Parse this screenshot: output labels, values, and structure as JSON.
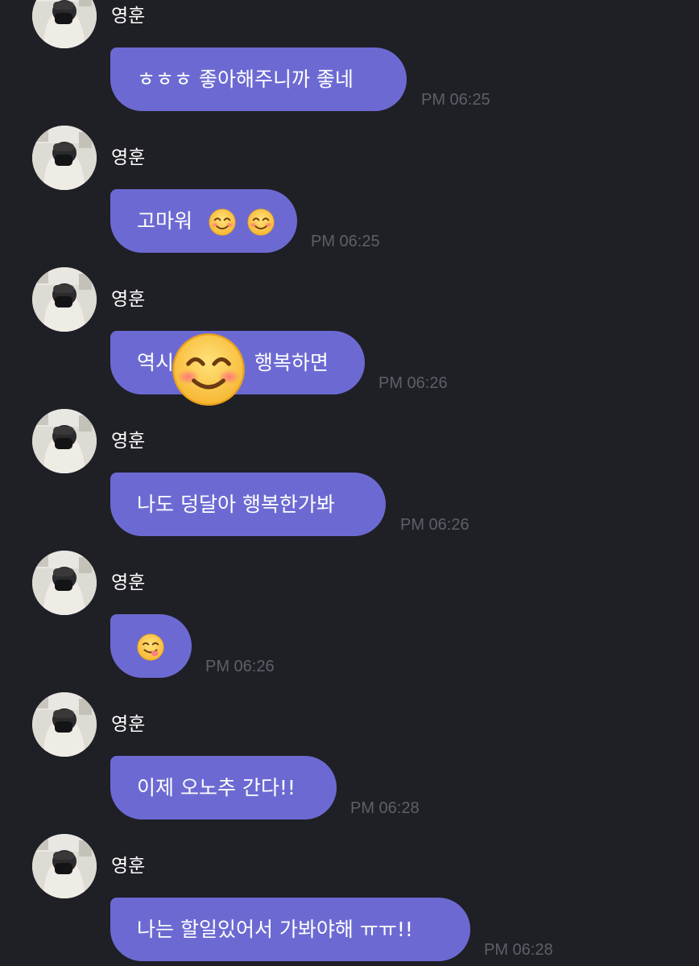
{
  "contact_name": "영훈",
  "colors": {
    "background": "#1f1f26",
    "bubble": "#6c6ad2",
    "timestamp": "#5f5f68"
  },
  "messages": [
    {
      "sender": "영훈",
      "text": "ㅎㅎㅎ 좋아해주니까 좋네",
      "time": "PM 06:25"
    },
    {
      "sender": "영훈",
      "text": "고마워",
      "emojis": [
        "smiling-blush-emoji",
        "smiling-blush-emoji"
      ],
      "time": "PM 06:25"
    },
    {
      "sender": "영훈",
      "text_before": "역시",
      "text_after": "행복하면",
      "overlay": "smiling-blush-emoji-sticker",
      "time": "PM 06:26"
    },
    {
      "sender": "영훈",
      "text": "나도 덩달아 행복한가봐",
      "time": "PM 06:26"
    },
    {
      "sender": "영훈",
      "emojis": [
        "yum-emoji"
      ],
      "time": "PM 06:26"
    },
    {
      "sender": "영훈",
      "text": "이제 오노추 간다!!",
      "time": "PM 06:28"
    },
    {
      "sender": "영훈",
      "text": "나는 할일있어서 가봐야해 ㅠㅠ!!",
      "time": "PM 06:28"
    }
  ]
}
